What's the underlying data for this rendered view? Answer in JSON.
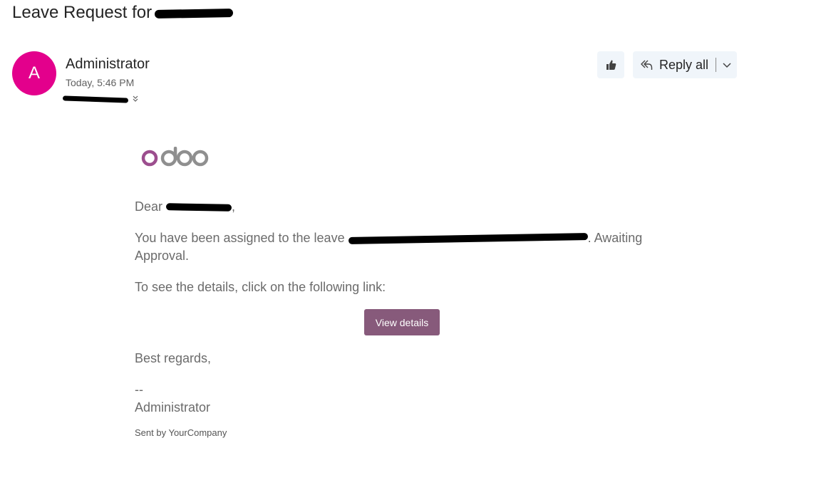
{
  "subject": {
    "prefix": "Leave Request for"
  },
  "sender": {
    "avatar_initial": "A",
    "name": "Administrator",
    "time": "Today, 5:46 PM"
  },
  "toolbar": {
    "reply_all_label": "Reply all"
  },
  "body": {
    "logo": "odoo",
    "greeting_prefix": "Dear",
    "greeting_suffix": ",",
    "assigned_prefix": "You have been assigned to the leave",
    "assigned_suffix": ". Awaiting",
    "assigned_line2": "Approval.",
    "details_text": "To see the details, click on the following link:",
    "view_details_label": "View details",
    "regards": "Best regards,",
    "signature_sep": "--",
    "signature_name": "Administrator",
    "sent_by": "Sent by YourCompany"
  },
  "colors": {
    "avatar": "#e3008c",
    "button": "#875a7b",
    "logo_o": "#9c4e8e",
    "logo_grey": "#8f8f8f",
    "toolbar_bg": "#f0f5fa"
  },
  "icons": {
    "react": "thumbs-up-icon",
    "reply_all": "reply-all-icon",
    "dropdown": "chevron-down-icon",
    "expand": "double-chevron-down-icon"
  }
}
